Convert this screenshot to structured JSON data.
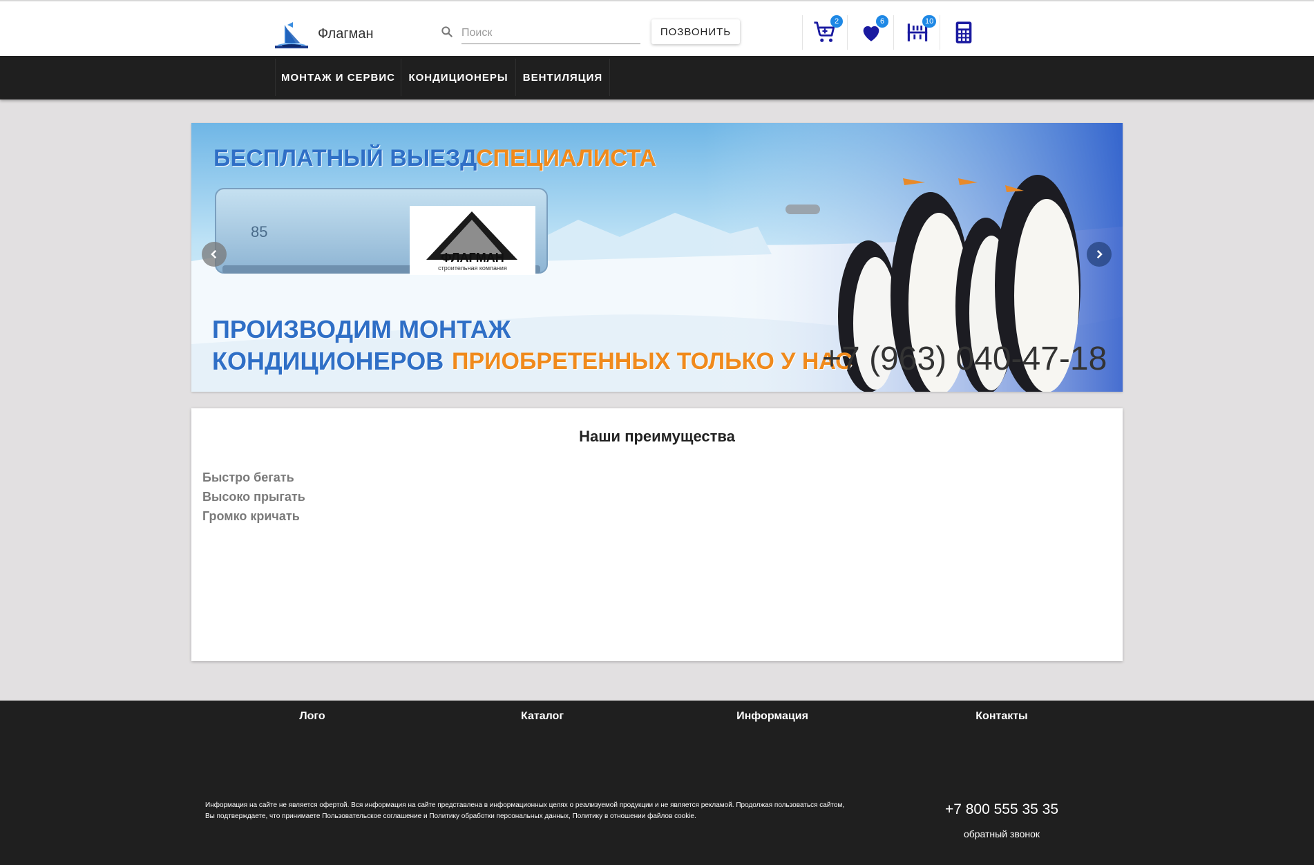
{
  "header": {
    "brand": "Флагман",
    "search_placeholder": "Поиск",
    "call_button": "ПОЗВОНИТЬ",
    "cart_count": "2",
    "favorites_count": "6",
    "compare_count": "10"
  },
  "nav": {
    "items": [
      {
        "label": "МОНТАЖ И СЕРВИС"
      },
      {
        "label": "КОНДИЦИОНЕРЫ"
      },
      {
        "label": "ВЕНТИЛЯЦИЯ"
      }
    ]
  },
  "banner": {
    "line1_a": "БЕСПЛАТНЫЙ ВЫЕЗД",
    "line1_b": "СПЕЦИАЛИСТА",
    "line2": "ПРОИЗВОДИМ МОНТАЖ",
    "line3_a": "КОНДИЦИОНЕРОВ",
    "line3_b": "ПРИОБРЕТЕННЫХ ТОЛЬКО У НАС",
    "phone": "+7 (963) 040-47-18",
    "logo_text": "ФЛАГМАН",
    "logo_subtext": "строительная компания",
    "ac_display": "85"
  },
  "advantages": {
    "title": "Наши преимущества",
    "items": [
      "Быстро бегать",
      "Высоко прыгать",
      "Громко кричать"
    ]
  },
  "footer": {
    "col_logo": "Лого",
    "col_catalog": "Каталог",
    "col_info": "Информация",
    "col_contacts": "Контакты",
    "legal": "Информация на сайте не является офертой. Вся информация на сайте представлена в информационных целях о реализуемой продукции и не является рекламой. Продолжая пользоваться сайтом, Вы подтверждаете, что принимаете Пользовательское соглашение и Политику обработки персональных данных, Политику в отношении файлов cookie.",
    "phone": "+7 800 555 35 35",
    "callback": "обратный звонок"
  },
  "colors": {
    "nav_bg": "#1f1f1f",
    "badge": "#1e88e5",
    "icons": "#1a1aa0",
    "page_bg": "#e2e0e1"
  },
  "icons": [
    "logo-ship-icon",
    "search-icon",
    "cart-icon",
    "heart-icon",
    "compare-icon",
    "calculator-icon",
    "chevron-left-icon",
    "chevron-right-icon"
  ]
}
